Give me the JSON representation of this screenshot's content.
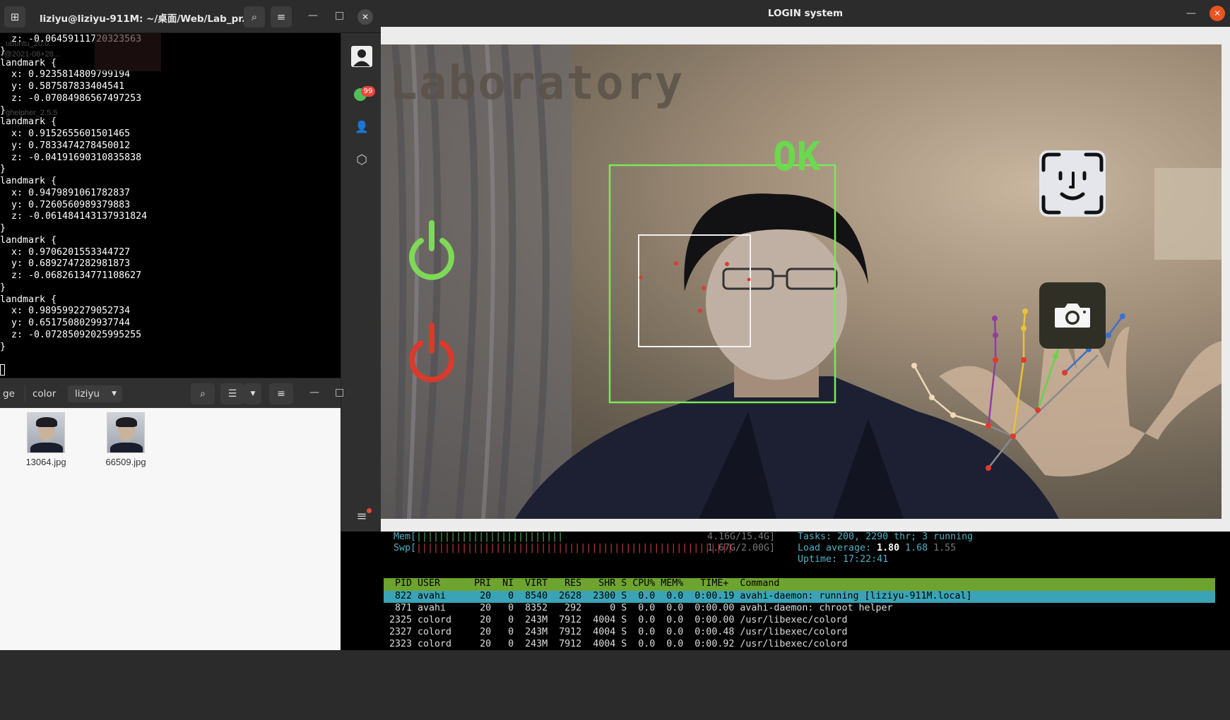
{
  "terminal": {
    "title": "liziyu@liziyu-911M: ~/桌面/Web/Lab_pr...",
    "lines": [
      "  z: -0.06459111720323563",
      "}",
      "landmark {",
      "  x: 0.9235814809799194",
      "  y: 0.587587833404541",
      "  z: -0.07084986567497253",
      "}",
      "landmark {",
      "  x: 0.9152655601501465",
      "  y: 0.7833474278450012",
      "  z: -0.04191690310835838",
      "}",
      "landmark {",
      "  x: 0.9479891061782837",
      "  y: 0.7260560989379883",
      "  z: -0.061484143137931824",
      "}",
      "landmark {",
      "  x: 0.9706201553344727",
      "  y: 0.6892747282981873",
      "  z: -0.06826134771108627",
      "}",
      "landmark {",
      "  x: 0.9895992279052734",
      "  y: 0.6517508029937744",
      "  z: -0.07285092025995255",
      "}",
      ""
    ],
    "ghost_labels": [
      "ubuntu_20.0...",
      "r@2021-08+28...",
      "ghelpher_2.5.5"
    ]
  },
  "chat_sidebar": {
    "badge": "99"
  },
  "file_manager": {
    "crumbs": [
      "ge",
      "color",
      "liziyu"
    ],
    "files": [
      {
        "name": "13064.jpg"
      },
      {
        "name": "66509.jpg"
      }
    ]
  },
  "login": {
    "title": "LOGIN system",
    "overlay_title": "Laboratory",
    "status": "OK",
    "colors": {
      "power_on": "#7ed957",
      "power_off": "#d93a2b",
      "face_box": "#7be85a",
      "inner_box": "#f2f2f2"
    }
  },
  "htop": {
    "mem_label": "Mem[",
    "mem_bar": "||||||||||||||||||||||||||",
    "mem_value": "4.16G/15.4G]",
    "swp_label": "Swp[",
    "swp_bar": "|||||||||||||||||||||||||||||||||||||||||||||||||||||||||||||||||||||||||||||||||||||||||||||||||||",
    "swp_value": "1.67G/2.00G]",
    "tasks_label": "Tasks: ",
    "tasks_value": "200, 2290 thr; 3 running",
    "load_label": "Load average: ",
    "load_1": "1.80",
    "load_5": "1.68",
    "load_15": "1.55",
    "uptime_label": "Uptime: ",
    "uptime_value": "17:22:41",
    "header": "  PID USER      PRI  NI  VIRT   RES   SHR S CPU% MEM%   TIME+  Command",
    "rows": [
      "  822 avahi      20   0  8540  2628  2300 S  0.0  0.0  0:00.19 avahi-daemon: running [liziyu-911M.local]",
      "  871 avahi      20   0  8352   292     0 S  0.0  0.0  0:00.00 avahi-daemon: chroot helper",
      " 2325 colord     20   0  243M  7912  4004 S  0.0  0.0  0:00.00 /usr/libexec/colord",
      " 2327 colord     20   0  243M  7912  4004 S  0.0  0.0  0:00.48 /usr/libexec/colord",
      " 2323 colord     20   0  243M  7912  4004 S  0.0  0.0  0:00.92 /usr/libexec/colord"
    ]
  }
}
